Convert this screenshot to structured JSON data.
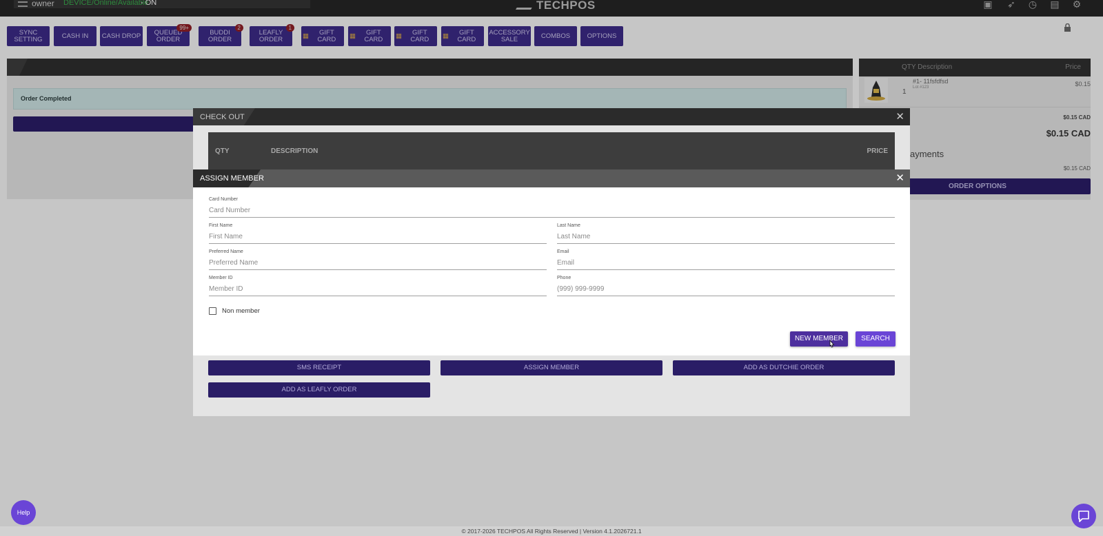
{
  "topbar": {
    "user": "owner",
    "connection_status": "DEVICE/Online/Available",
    "online_flag": "- ON",
    "logo": "TECHPOS",
    "icons": [
      "video-icon",
      "rocket-icon",
      "clock-icon",
      "calendar-icon",
      "gear-icon"
    ]
  },
  "toolbar": {
    "buttons": [
      {
        "label": "SYNC SETTING"
      },
      {
        "label": "CASH IN"
      },
      {
        "label": "CASH DROP"
      },
      {
        "label": "QUEUED ORDER",
        "badge": "99+"
      },
      {
        "label": "BUDDI ORDER",
        "badge": "2"
      },
      {
        "label": "LEAFLY ORDER",
        "badge": "1"
      },
      {
        "label": "GIFT CARD"
      },
      {
        "label": "GIFT CARD"
      },
      {
        "label": "GIFT CARD"
      },
      {
        "label": "GIFT CARD"
      },
      {
        "label": "ACCESSORY SALE"
      },
      {
        "label": "COMBOS"
      },
      {
        "label": "OPTIONS"
      }
    ]
  },
  "left_panel": {
    "notice": "Order Completed"
  },
  "cart": {
    "header_qty_desc": "QTY Description",
    "header_price": "Price",
    "item": {
      "qty": "1",
      "name": "#1- 11fsfdfsd",
      "sub": "Lot #123",
      "price": "$0.15"
    },
    "subtotal": "$0.15 CAD",
    "total": "$0.15 CAD",
    "payments_label": "ayments",
    "payment_amount": "$0.15 CAD",
    "order_options": "ORDER OPTIONS"
  },
  "checkout": {
    "title": "CHECK OUT",
    "columns": {
      "qty": "QTY",
      "description": "DESCRIPTION",
      "price": "PRICE"
    },
    "buttons": {
      "sms_receipt": "SMS RECEIPT",
      "assign_member": "ASSIGN MEMBER",
      "add_dutchie": "ADD AS DUTCHIE ORDER",
      "add_leafly": "ADD AS LEAFLY ORDER"
    }
  },
  "assign_member": {
    "title": "ASSIGN MEMBER",
    "fields": {
      "card_number": {
        "label": "Card Number",
        "placeholder": "Card Number"
      },
      "first_name": {
        "label": "First Name",
        "placeholder": "First Name"
      },
      "last_name": {
        "label": "Last Name",
        "placeholder": "Last Name"
      },
      "preferred_name": {
        "label": "Preferred Name",
        "placeholder": "Preferred Name"
      },
      "email": {
        "label": "Email",
        "placeholder": "Email"
      },
      "member_id": {
        "label": "Member ID",
        "placeholder": "Member ID"
      },
      "phone": {
        "label": "Phone",
        "placeholder": "(999) 999-9999"
      }
    },
    "non_member_label": "Non member",
    "new_member_button": "NEW MEMBER",
    "search_button": "SEARCH"
  },
  "footer": {
    "copyright": "© 2017-2026 TECHPOS All Rights Reserved | Version 4.1.2026721.1",
    "help": "Help"
  },
  "colors": {
    "accent": "#3b2a86",
    "accent_light": "#6a45d6",
    "topbar": "#1e1e1e"
  }
}
